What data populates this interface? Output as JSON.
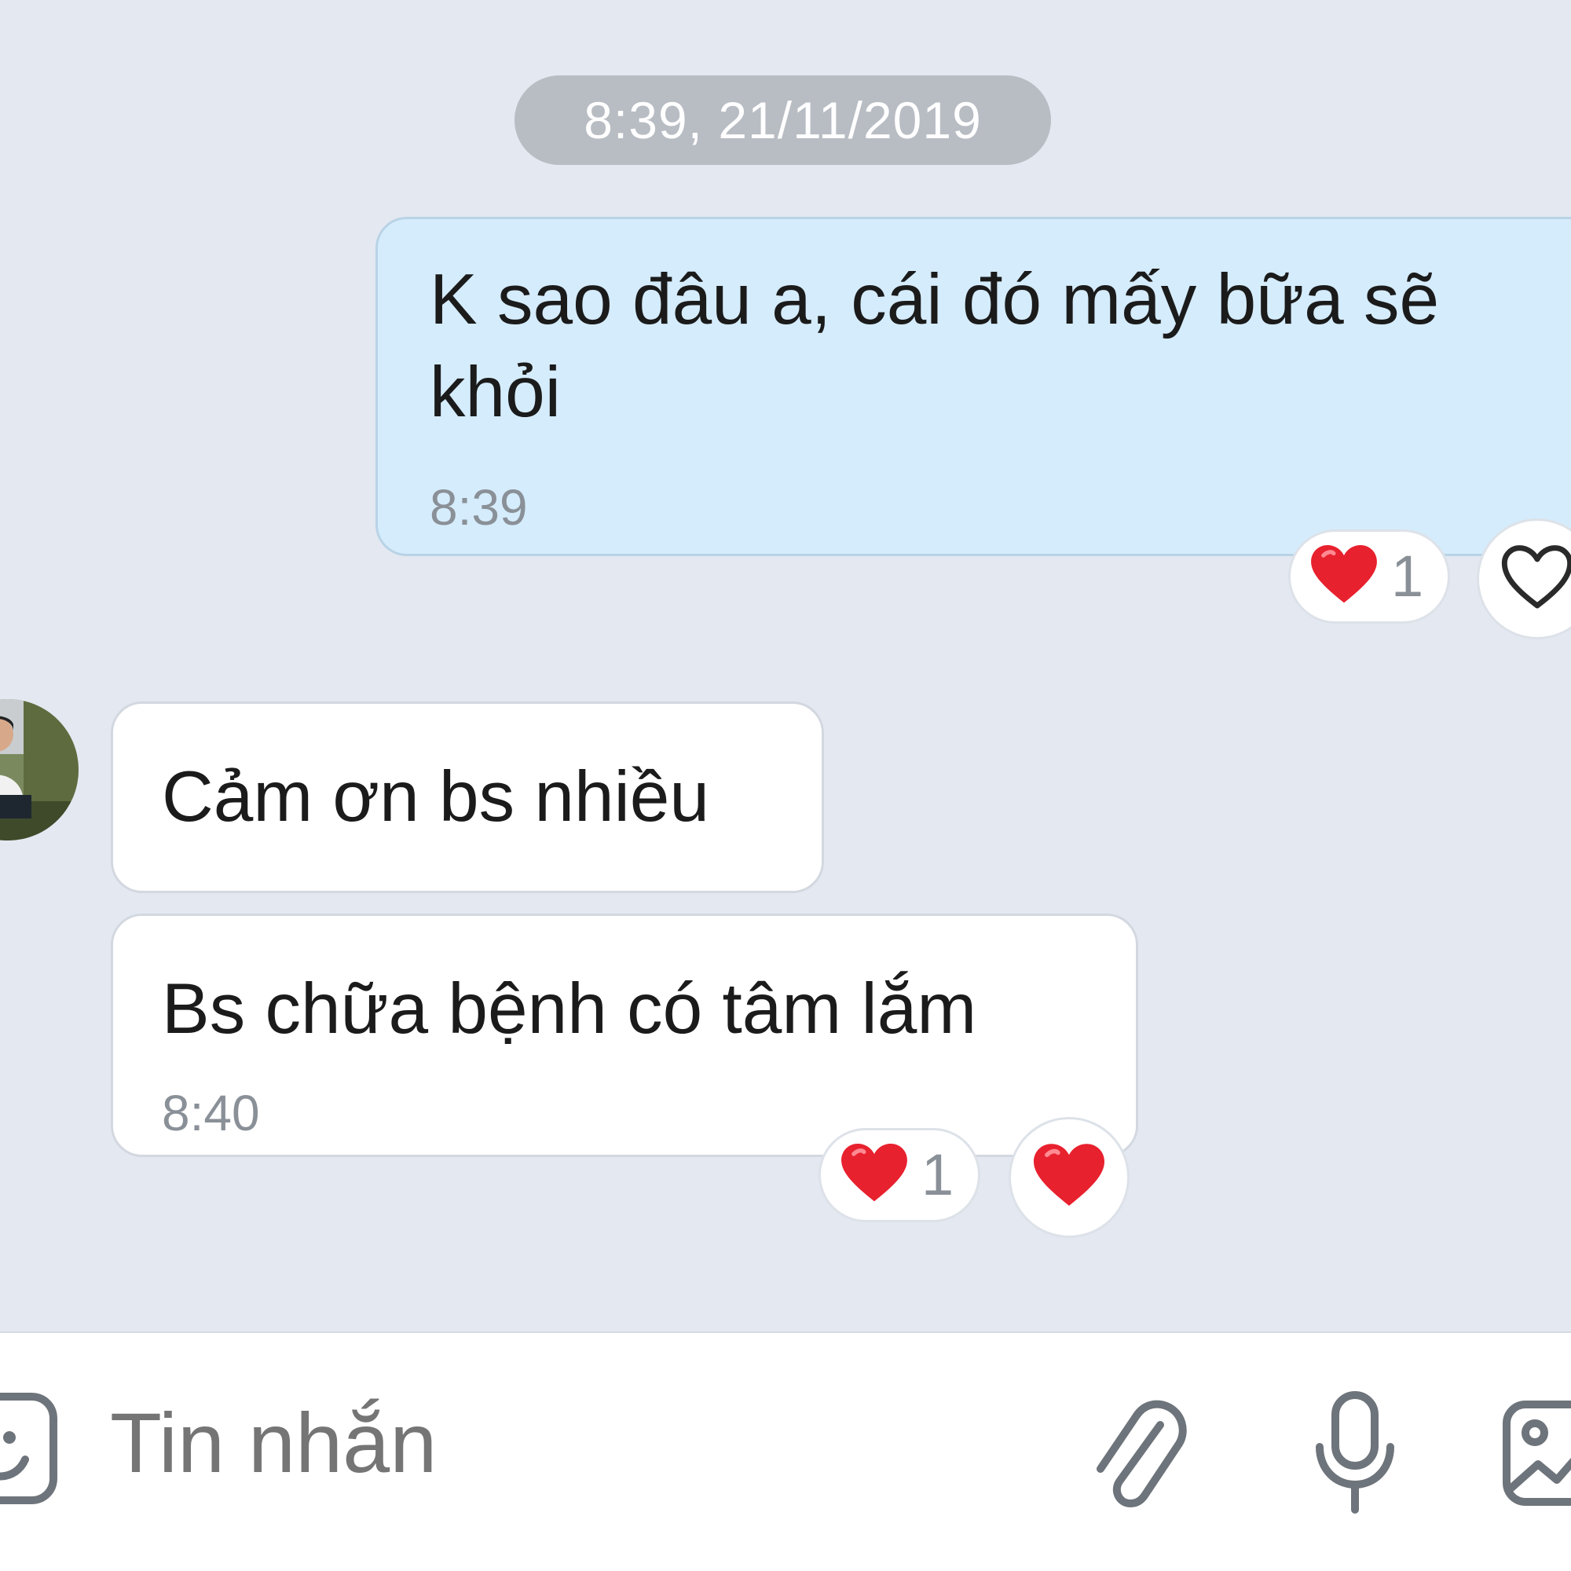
{
  "conversation": {
    "date_separator": "8:39, 21/11/2019",
    "messages": [
      {
        "direction": "outgoing",
        "text": "K sao đâu a, cái đó mấy bữa sẽ khỏi",
        "time": "8:39",
        "reaction": {
          "icon": "red-heart-icon",
          "count": "1"
        },
        "react_button": "heart-outline-icon"
      },
      {
        "direction": "incoming",
        "text": "Cảm ơn bs nhiều"
      },
      {
        "direction": "incoming",
        "text": "Bs chữa bệnh có tâm lắm",
        "time": "8:40",
        "reaction": {
          "icon": "red-heart-icon",
          "count": "1"
        },
        "react_button": "red-heart-icon"
      }
    ]
  },
  "composer": {
    "placeholder": "Tin nhắn",
    "icons": [
      "emoji-icon",
      "paperclip-icon",
      "microphone-icon",
      "image-icon"
    ]
  },
  "colors": {
    "background": "#e3e8f1",
    "outgoing_bubble": "#d5ecfc",
    "incoming_bubble": "#ffffff",
    "heart": "#e8212e",
    "date_pill": "#b8bcc3"
  }
}
